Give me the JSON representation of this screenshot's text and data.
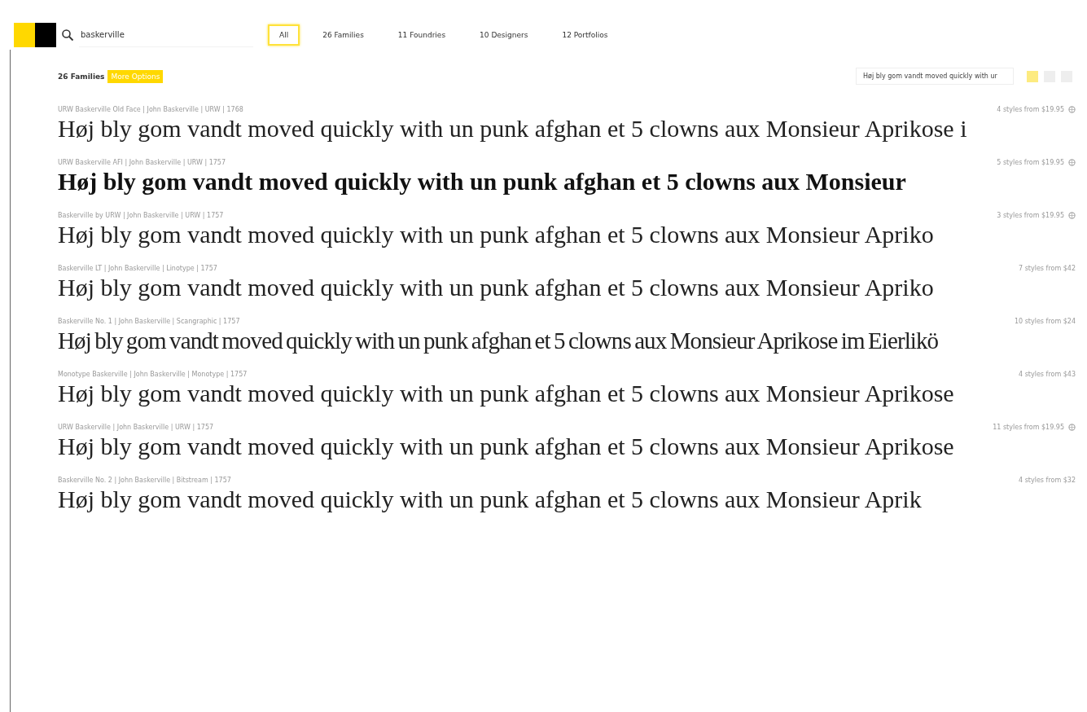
{
  "search": {
    "value": "baskerville"
  },
  "tabs": [
    {
      "label": "All",
      "selected": true
    },
    {
      "label": "26 Families",
      "selected": false
    },
    {
      "label": "11 Foundries",
      "selected": false
    },
    {
      "label": "10 Designers",
      "selected": false
    },
    {
      "label": "12 Portfolios",
      "selected": false
    }
  ],
  "results": {
    "count": "26 Families",
    "options_button": "More Options",
    "preview_text": "Høj bly gom vandt moved quickly with ur"
  },
  "views": [
    {
      "selected": true
    },
    {
      "selected": false
    },
    {
      "selected": false
    }
  ],
  "fonts": [
    {
      "meta": "URW Baskerville Old Face | John Baskerville | URW | 1768",
      "price": "4 styles from $19.95",
      "has_icon": true,
      "kind": "regular",
      "sample": "Høj bly gom vandt moved quickly with un punk afghan et 5 clowns aux Monsieur Aprikose i"
    },
    {
      "meta": "URW Baskerville AFI | John Baskerville | URW | 1757",
      "price": "5 styles from $19.95",
      "has_icon": true,
      "kind": "bold",
      "sample": "Høj bly gom vandt moved quickly with un punk afghan et 5 clowns aux Monsieur"
    },
    {
      "meta": "Baskerville by URW | John Baskerville | URW | 1757",
      "price": "3 styles from $19.95",
      "has_icon": true,
      "kind": "regular",
      "sample": "Høj bly gom vandt moved quickly with un punk afghan et 5 clowns aux Monsieur Apriko"
    },
    {
      "meta": "Baskerville LT | John Baskerville | Linotype | 1757",
      "price": "7 styles from $42",
      "has_icon": false,
      "kind": "regular",
      "sample": "Høj bly gom vandt moved quickly with un punk afghan et 5 clowns aux Monsieur Apriko"
    },
    {
      "meta": "Baskerville No. 1 | John Baskerville | Scangraphic | 1757",
      "price": "10 styles from $24",
      "has_icon": false,
      "kind": "condensed",
      "sample": "Høj bly gom vandt moved quickly with un punk afghan et 5 clowns aux Monsieur Aprikose im Eierlikö"
    },
    {
      "meta": "Monotype Baskerville | John Baskerville | Monotype | 1757",
      "price": "4 styles from $43",
      "has_icon": false,
      "kind": "regular",
      "sample": "Høj bly gom vandt moved quickly with un punk afghan et 5 clowns aux Monsieur Aprikose"
    },
    {
      "meta": "URW Baskerville | John Baskerville | URW | 1757",
      "price": "11 styles from $19.95",
      "has_icon": true,
      "kind": "regular",
      "sample": "Høj bly gom vandt moved quickly with un punk afghan et 5 clowns aux Monsieur Aprikose"
    },
    {
      "meta": "Baskerville No. 2 | John Baskerville | Bitstream | 1757",
      "price": "4 styles from $32",
      "has_icon": false,
      "kind": "regular",
      "sample": "Høj bly gom vandt moved quickly with un punk afghan et 5 clowns aux Monsieur Aprik"
    }
  ]
}
